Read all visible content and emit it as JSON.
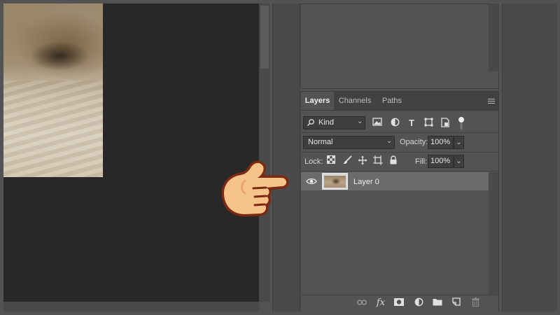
{
  "panel_tabs": [
    "Layers",
    "Channels",
    "Paths"
  ],
  "filter": {
    "label": "Kind"
  },
  "blend": {
    "mode": "Normal",
    "opacity_label": "Opacity:",
    "opacity_value": "100%"
  },
  "lock": {
    "label": "Lock:",
    "fill_label": "Fill:",
    "fill_value": "100%"
  },
  "layers": [
    {
      "name": "Layer 0",
      "visible": true,
      "selected": true
    }
  ],
  "icons": {
    "filter": [
      "image-filter-icon",
      "adjustment-filter-icon",
      "type-filter-icon",
      "shape-filter-icon",
      "smart-object-filter-icon",
      "filter-toggle-icon"
    ],
    "lock": [
      "lock-transparent-pixels-icon",
      "lock-image-pixels-icon",
      "lock-position-icon",
      "lock-artboard-icon",
      "lock-all-icon"
    ],
    "bottom": [
      "link-layers-icon",
      "fx-icon",
      "add-mask-icon",
      "adjustment-layer-icon",
      "new-group-icon",
      "new-layer-icon",
      "delete-layer-icon"
    ]
  },
  "colors": {
    "panel": "#535353",
    "canvas": "#282828",
    "selected_row": "#6b6b6b",
    "hand_fill": "#f6c38b",
    "hand_outline": "#7a2a12"
  }
}
